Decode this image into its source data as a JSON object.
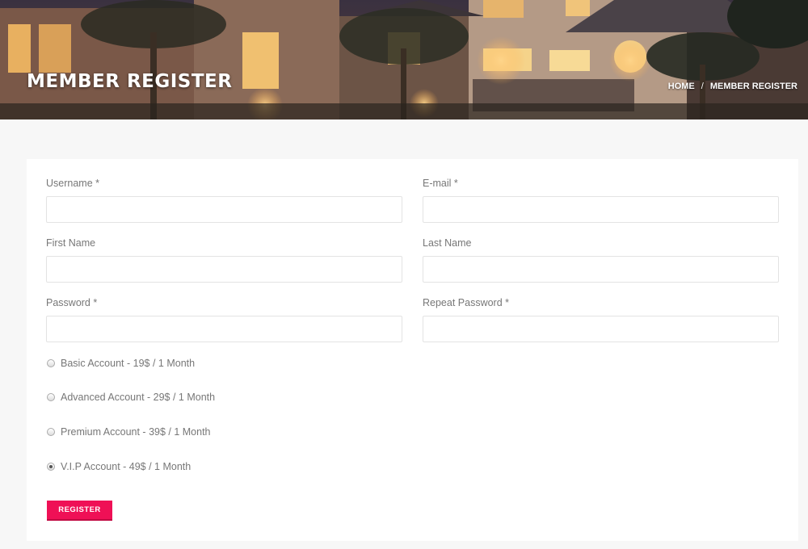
{
  "hero": {
    "title": "MEMBER REGISTER",
    "breadcrumb": {
      "home": "HOME",
      "separator": "/",
      "current": "MEMBER REGISTER"
    }
  },
  "form": {
    "fields": {
      "username": {
        "label": "Username *",
        "value": ""
      },
      "email": {
        "label": "E-mail *",
        "value": ""
      },
      "first_name": {
        "label": "First Name",
        "value": ""
      },
      "last_name": {
        "label": "Last Name",
        "value": ""
      },
      "password": {
        "label": "Password *",
        "value": ""
      },
      "repeat_password": {
        "label": "Repeat Password *",
        "value": ""
      }
    },
    "plans": [
      {
        "label": "Basic Account - 19$ / 1 Month",
        "checked": false
      },
      {
        "label": "Advanced Account - 29$ / 1 Month",
        "checked": false
      },
      {
        "label": "Premium Account - 39$ / 1 Month",
        "checked": false
      },
      {
        "label": "V.I.P Account - 49$ / 1 Month",
        "checked": true
      }
    ],
    "submit_label": "REGISTER"
  },
  "colors": {
    "accent": "#ef1056",
    "background": "#f7f7f7",
    "card": "#ffffff"
  }
}
